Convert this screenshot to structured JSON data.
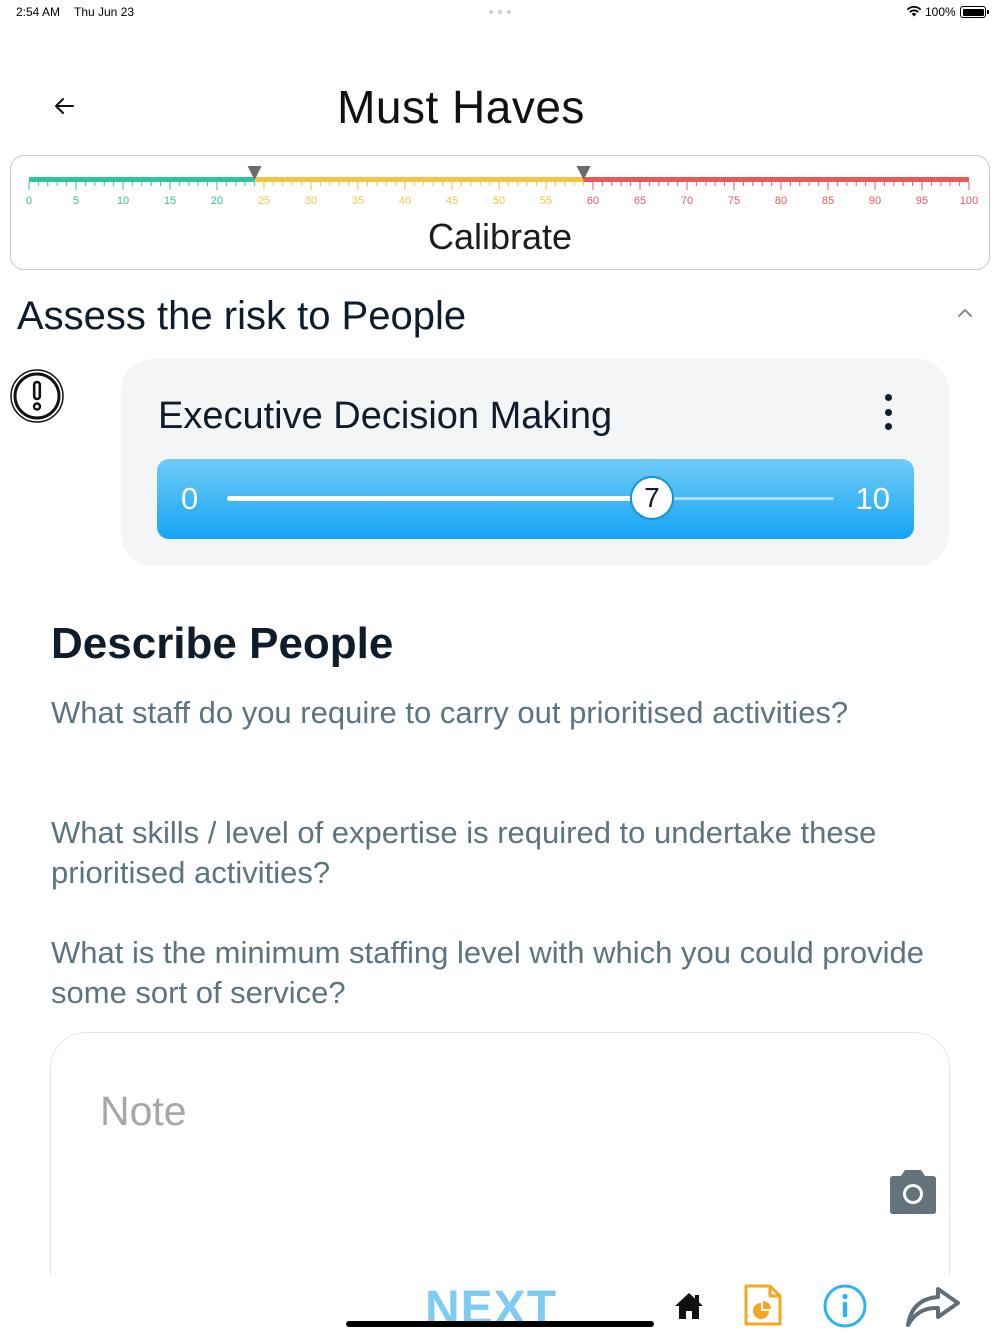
{
  "status_bar": {
    "time": "2:54 AM",
    "date": "Thu Jun 23",
    "battery": "100%"
  },
  "header": {
    "title": "Must Haves",
    "back_icon": "arrow-left-icon"
  },
  "calibrate": {
    "label": "Calibrate",
    "scale_min": 0,
    "scale_max": 100,
    "tick_labels": [
      "0",
      "5",
      "10",
      "15",
      "20",
      "25",
      "30",
      "35",
      "40",
      "45",
      "50",
      "55",
      "60",
      "65",
      "70",
      "75",
      "80",
      "85",
      "90",
      "95",
      "100"
    ],
    "markers": [
      24,
      59
    ],
    "zones": [
      {
        "from": 0,
        "to": 24,
        "color": "#2fc2a4"
      },
      {
        "from": 24,
        "to": 59,
        "color": "#f2c545"
      },
      {
        "from": 59,
        "to": 100,
        "color": "#e85a5a"
      }
    ]
  },
  "section": {
    "title": "Assess the risk to People"
  },
  "score_card": {
    "title": "Executive Decision Making",
    "min_label": "0",
    "max_label": "10",
    "value": 7,
    "value_label": "7",
    "min": 0,
    "max": 10,
    "slider_color_top": "#70ccf7",
    "slider_color_bottom": "#15a4f3"
  },
  "describe": {
    "title": "Describe People",
    "questions": [
      "What staff do you require to carry out prioritised activities?",
      "What skills / level of expertise is required to undertake these prioritised activities?",
      "What is the minimum staffing level with which you could provide some sort of service?"
    ]
  },
  "note": {
    "placeholder": "Note"
  },
  "bottom_bar": {
    "next_label": "NEXT",
    "icons": [
      "home-icon",
      "report-icon",
      "info-icon",
      "share-icon"
    ],
    "accent_orange": "#f5a623",
    "accent_blue": "#2bb5f0"
  }
}
